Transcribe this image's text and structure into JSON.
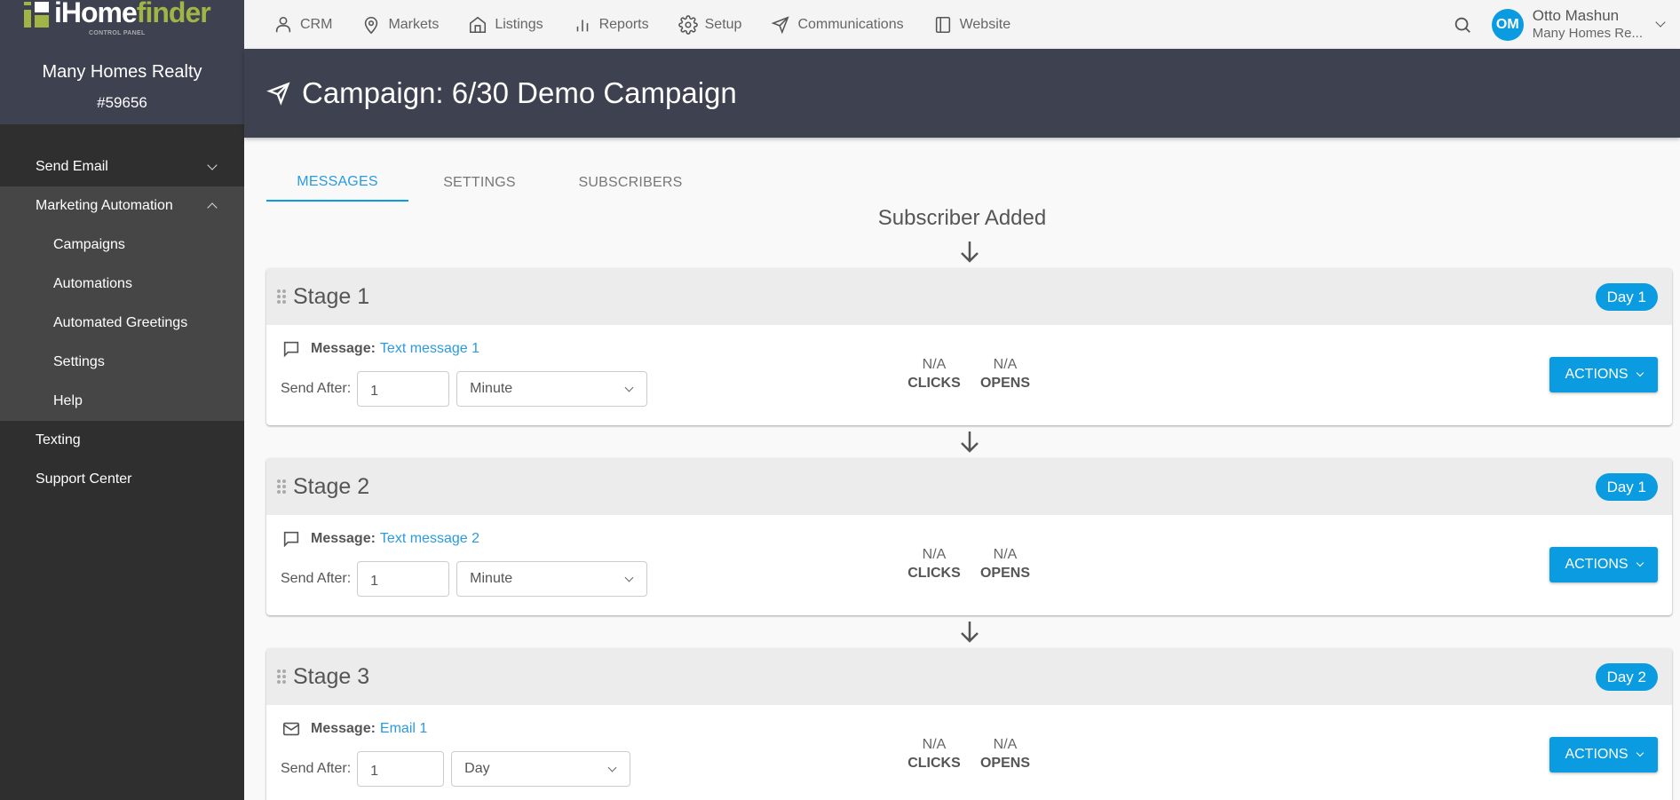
{
  "brand": {
    "logo_text_main": "iHome",
    "logo_text_accent": "finder",
    "logo_subtitle": "CONTROL PANEL",
    "company": "Many Homes Realty",
    "account_number": "#59656",
    "accent_green": "#a0b546"
  },
  "sidebar": {
    "items": [
      {
        "label": "Send Email",
        "expandable": true,
        "expanded": false
      },
      {
        "label": "Marketing Automation",
        "expandable": true,
        "expanded": true,
        "children": [
          "Campaigns",
          "Automations",
          "Automated Greetings",
          "Settings",
          "Help"
        ]
      },
      {
        "label": "Texting"
      },
      {
        "label": "Support Center"
      }
    ]
  },
  "topnav": {
    "items": [
      {
        "label": "CRM",
        "icon": "user-icon"
      },
      {
        "label": "Markets",
        "icon": "map-pin-icon"
      },
      {
        "label": "Listings",
        "icon": "home-icon"
      },
      {
        "label": "Reports",
        "icon": "bar-chart-icon"
      },
      {
        "label": "Setup",
        "icon": "gear-icon"
      },
      {
        "label": "Communications",
        "icon": "send-icon"
      },
      {
        "label": "Website",
        "icon": "sidebar-layout-icon"
      }
    ],
    "user": {
      "initials": "OM",
      "name": "Otto Mashun",
      "org": "Many Homes Re..."
    }
  },
  "header": {
    "title": "Campaign: 6/30 Demo Campaign",
    "icon": "send-icon"
  },
  "tabs": [
    {
      "label": "MESSAGES",
      "active": true
    },
    {
      "label": "SETTINGS",
      "active": false
    },
    {
      "label": "SUBSCRIBERS",
      "active": false
    }
  ],
  "flow": {
    "start_label": "Subscriber Added"
  },
  "stages": [
    {
      "title": "Stage 1",
      "day": "Day 1",
      "message_type": "text",
      "message_label": "Message:",
      "message_name": "Text message 1",
      "send_after_label": "Send After:",
      "send_after_value": "1",
      "send_after_unit": "Minute",
      "clicks_value": "N/A",
      "clicks_label": "CLICKS",
      "opens_value": "N/A",
      "opens_label": "OPENS",
      "actions_label": "ACTIONS"
    },
    {
      "title": "Stage 2",
      "day": "Day 1",
      "message_type": "text",
      "message_label": "Message:",
      "message_name": "Text message 2",
      "send_after_label": "Send After:",
      "send_after_value": "1",
      "send_after_unit": "Minute",
      "clicks_value": "N/A",
      "clicks_label": "CLICKS",
      "opens_value": "N/A",
      "opens_label": "OPENS",
      "actions_label": "ACTIONS"
    },
    {
      "title": "Stage 3",
      "day": "Day 2",
      "message_type": "email",
      "message_label": "Message:",
      "message_name": "Email 1",
      "send_after_label": "Send After:",
      "send_after_value": "1",
      "send_after_unit": "Day",
      "clicks_value": "N/A",
      "clicks_label": "CLICKS",
      "opens_value": "N/A",
      "opens_label": "OPENS",
      "actions_label": "ACTIONS"
    }
  ],
  "colors": {
    "primary": "#0a9be0",
    "header_bg": "#3d4150",
    "sidebar_bg": "#2f2f2f",
    "sidebar_group_bg": "#464646"
  }
}
